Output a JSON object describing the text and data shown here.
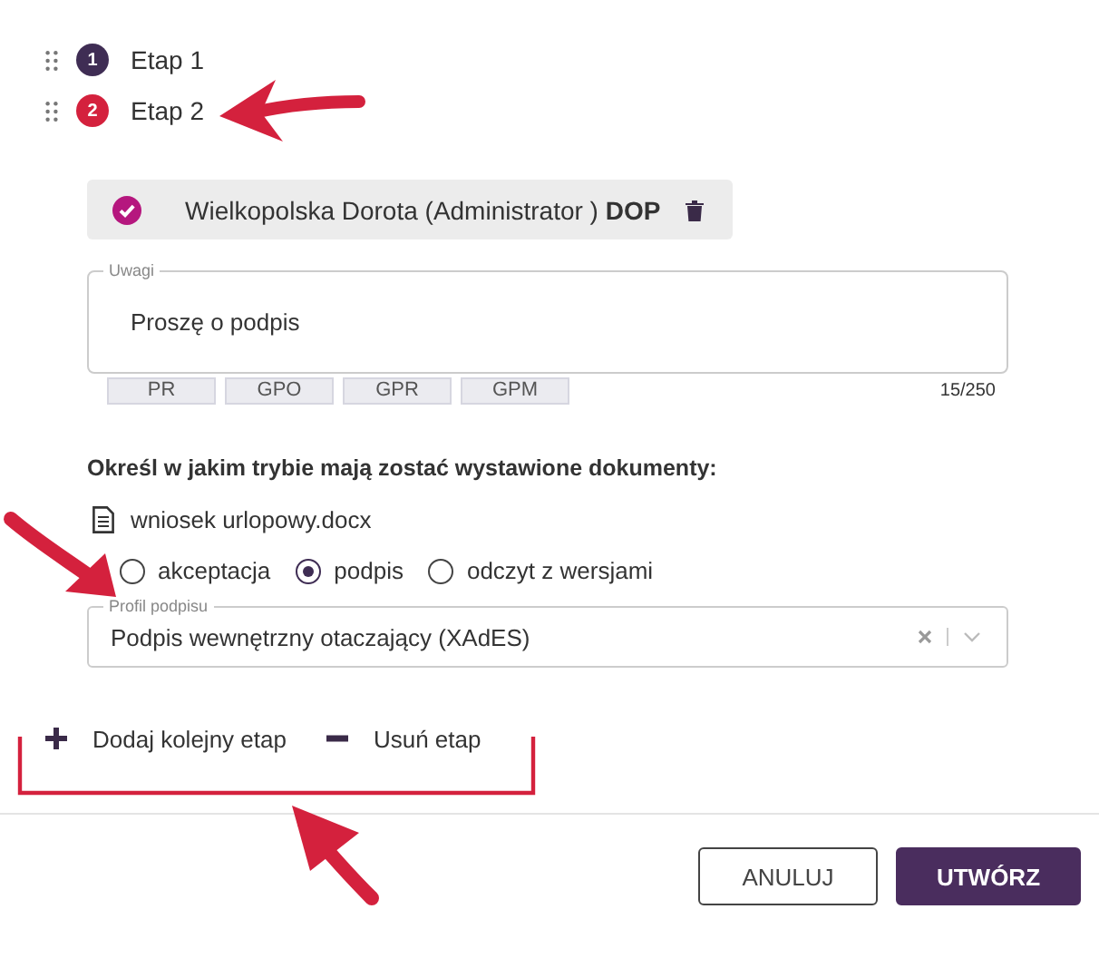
{
  "stages": [
    {
      "number": "1",
      "label": "Etap 1",
      "selected": false
    },
    {
      "number": "2",
      "label": "Etap 2",
      "selected": true
    }
  ],
  "approver": {
    "text": "Wielkopolska Dorota (Administrator ) **DOP**",
    "checked": true
  },
  "remarks": {
    "label": "Uwagi",
    "value": "Proszę o podpis",
    "counter": "15/250"
  },
  "tags": [
    "PR",
    "GPO",
    "GPR",
    "GPM"
  ],
  "mode_heading": "Określ w jakim trybie mają zostać wystawione dokumenty:",
  "document": {
    "name": "wniosek urlopowy.docx"
  },
  "modes": [
    {
      "label": "akceptacja",
      "selected": false
    },
    {
      "label": "podpis",
      "selected": true
    },
    {
      "label": "odczyt z wersjami",
      "selected": false
    }
  ],
  "signature_profile": {
    "label": "Profil podpisu",
    "value": "Podpis wewnętrzny otaczający (XAdES)"
  },
  "stage_actions": [
    {
      "kind": "add",
      "label": "Dodaj kolejny etap"
    },
    {
      "kind": "remove",
      "label": "Usuń etap"
    }
  ],
  "buttons": [
    {
      "kind": "secondary",
      "label": "ANULUJ"
    },
    {
      "kind": "primary",
      "label": "UTWÓRZ"
    }
  ]
}
